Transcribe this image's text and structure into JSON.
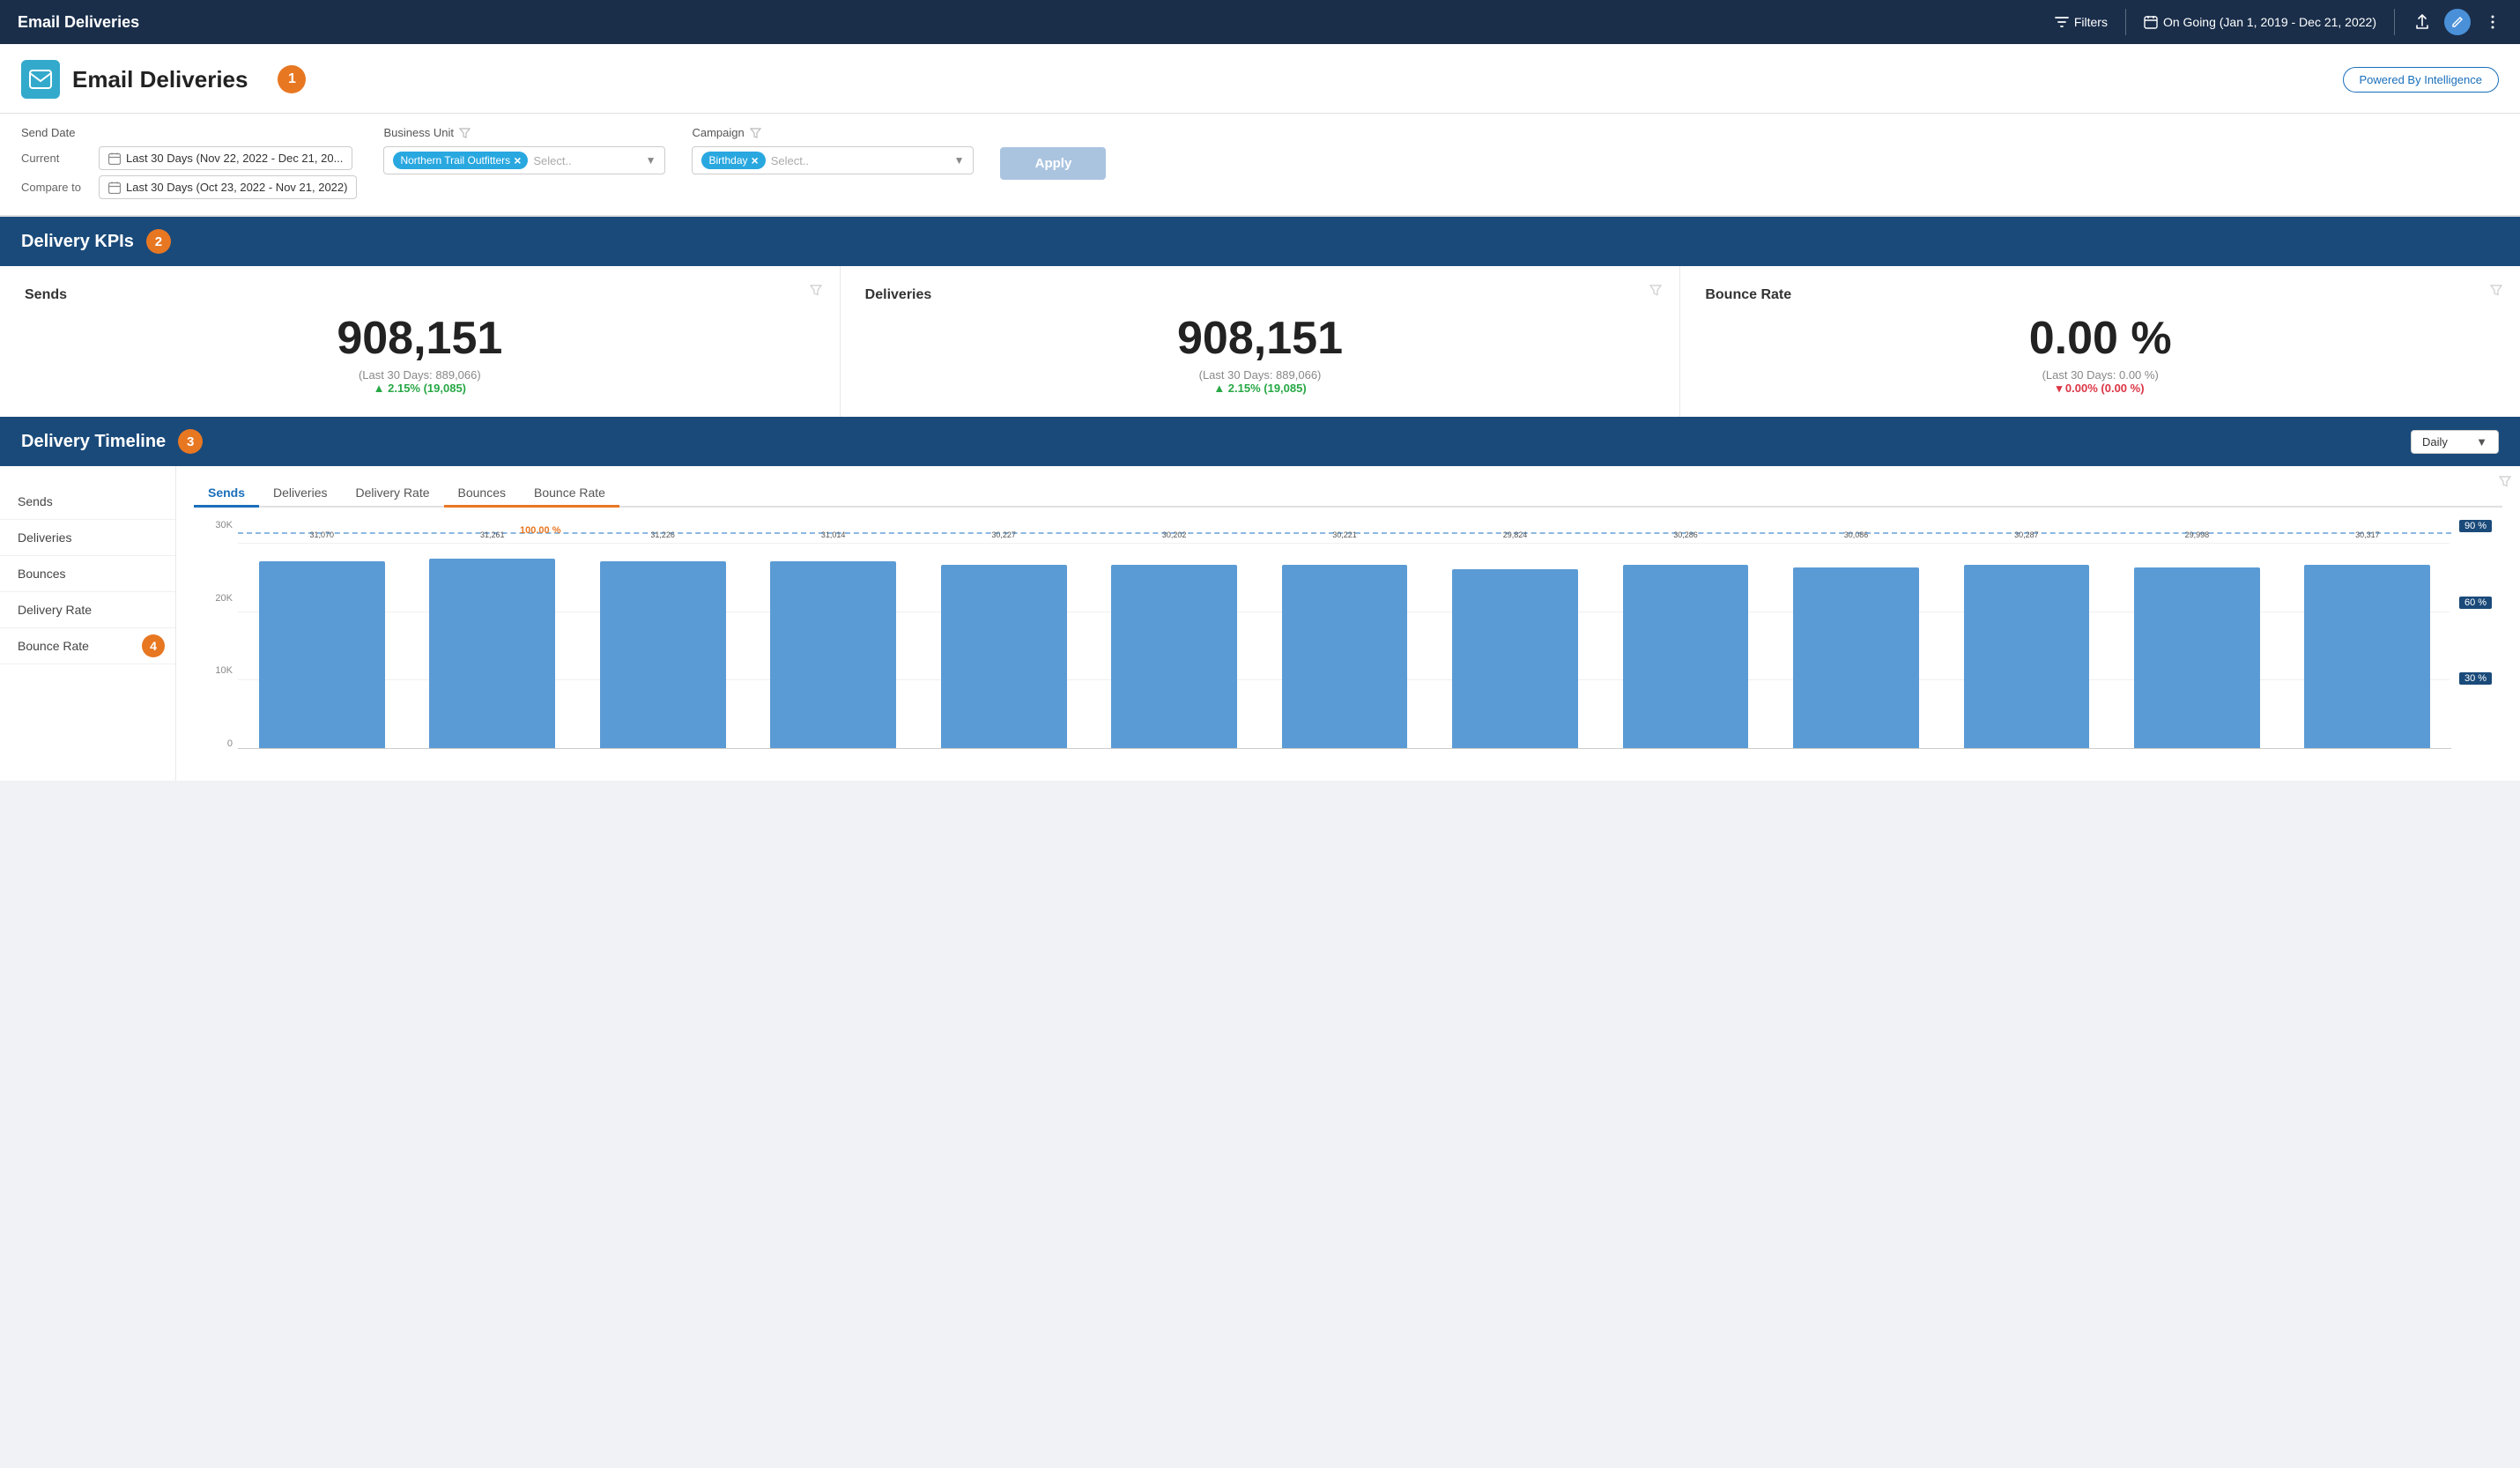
{
  "topnav": {
    "title": "Email Deliveries",
    "filter_label": "Filters",
    "date_range": "On Going (Jan 1, 2019 - Dec 21, 2022)"
  },
  "header": {
    "title": "Email Deliveries",
    "step": "1",
    "powered_by": "Powered By Intelligence"
  },
  "filters": {
    "send_date_label": "Send Date",
    "current_label": "Current",
    "compare_label": "Compare to",
    "current_date": "Last 30 Days (Nov 22, 2022 - Dec 21, 20...",
    "compare_date": "Last 30 Days (Oct 23, 2022 - Nov 21, 2022)",
    "business_unit_label": "Business Unit",
    "campaign_label": "Campaign",
    "business_unit_tag": "Northern Trail Outfitters",
    "business_unit_placeholder": "Select..",
    "campaign_tag": "Birthday",
    "campaign_placeholder": "Select..",
    "apply_label": "Apply"
  },
  "kpis": {
    "section_title": "Delivery KPIs",
    "step": "2",
    "sends": {
      "title": "Sends",
      "value": "908,151",
      "compare": "(Last 30 Days: 889,066)",
      "change": "▲ 2.15% (19,085)",
      "change_type": "positive"
    },
    "deliveries": {
      "title": "Deliveries",
      "value": "908,151",
      "compare": "(Last 30 Days: 889,066)",
      "change": "▲ 2.15% (19,085)",
      "change_type": "positive"
    },
    "bounce_rate": {
      "title": "Bounce Rate",
      "value": "0.00 %",
      "compare": "(Last 30 Days: 0.00 %)",
      "change": "▾ 0.00% (0.00 %)",
      "change_type": "negative"
    }
  },
  "timeline": {
    "section_title": "Delivery Timeline",
    "step": "3",
    "daily_label": "Daily",
    "legend": [
      "Sends",
      "Deliveries",
      "Bounces",
      "Delivery Rate",
      "Bounce Rate"
    ],
    "legend_step": "4",
    "tabs": [
      "Sends",
      "Deliveries",
      "Delivery Rate",
      "Bounces",
      "Bounce Rate"
    ],
    "active_tab": 0,
    "y_axis": [
      "30K",
      "20K",
      "10K",
      "0"
    ],
    "y_axis_right": [
      "90 %",
      "60 %",
      "30 %"
    ],
    "bars": [
      {
        "label": "31,070",
        "height": 92
      },
      {
        "label": "31,261",
        "height": 93
      },
      {
        "label": "31,226",
        "height": 92
      },
      {
        "label": "31,014",
        "height": 92
      },
      {
        "label": "30,227",
        "height": 90
      },
      {
        "label": "30,202",
        "height": 90
      },
      {
        "label": "30,221",
        "height": 90
      },
      {
        "label": "29,824",
        "height": 88
      },
      {
        "label": "30,286",
        "height": 90
      },
      {
        "label": "30,086",
        "height": 89
      },
      {
        "label": "30,287",
        "height": 90
      },
      {
        "label": "29,998",
        "height": 89
      },
      {
        "label": "30,317",
        "height": 90
      }
    ],
    "hundred_percent_label": "100.00 %"
  }
}
